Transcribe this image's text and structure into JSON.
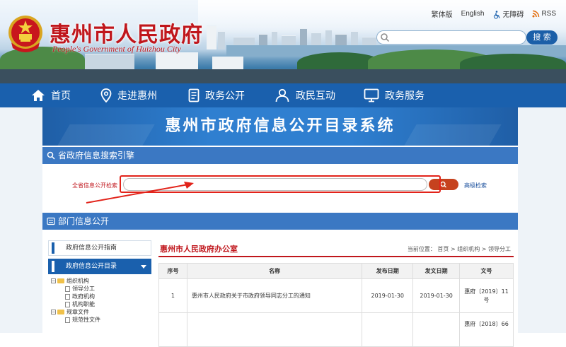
{
  "header": {
    "site_title": "惠州市人民政府",
    "site_subtitle": "People's Government of Huizhou City",
    "top_links": {
      "traditional": "繁体版",
      "english": "English",
      "accessible": "无障碍",
      "rss": "RSS"
    },
    "search": {
      "placeholder": "",
      "button_label": "搜 索"
    }
  },
  "nav": {
    "items": [
      {
        "label": "首页",
        "icon": "home-icon"
      },
      {
        "label": "走进惠州",
        "icon": "location-pin-icon"
      },
      {
        "label": "政务公开",
        "icon": "document-icon"
      },
      {
        "label": "政民互动",
        "icon": "people-icon"
      },
      {
        "label": "政务服务",
        "icon": "monitor-icon"
      }
    ]
  },
  "system_title": "惠州市政府信息公开目录系统",
  "province_search": {
    "section_title": "省政府信息搜索引擎",
    "label": "全省信息公开检索",
    "advanced_label": "高级检索"
  },
  "dept_section_title": "部门信息公开",
  "sidebar": {
    "items": [
      {
        "label": "政府信息公开指南"
      },
      {
        "label": "政府信息公开目录",
        "active": true
      }
    ],
    "tree": [
      {
        "label": "组织机构",
        "type": "folder",
        "expanded": true
      },
      {
        "label": "领导分工",
        "type": "doc"
      },
      {
        "label": "政府机构",
        "type": "doc"
      },
      {
        "label": "机构职能",
        "type": "doc"
      },
      {
        "label": "规章文件",
        "type": "folder",
        "expanded": true
      },
      {
        "label": "规范性文件",
        "type": "doc"
      }
    ]
  },
  "dept": {
    "name": "惠州市人民政府办公室",
    "location_label": "当前位置：",
    "breadcrumb": [
      "首页",
      "组织机构",
      "领导分工"
    ]
  },
  "table": {
    "headers": [
      "序号",
      "名称",
      "发布日期",
      "发文日期",
      "文号"
    ],
    "rows": [
      {
        "index": "1",
        "title": "惠州市人民政府关于市政府领导同志分工的通知",
        "publish_date": "2019-01-30",
        "issue_date": "2019-01-30",
        "doc_number": "惠府〔2019〕11号"
      },
      {
        "index": "",
        "title": "",
        "publish_date": "",
        "issue_date": "",
        "doc_number": "惠府〔2018〕66"
      }
    ]
  },
  "colors": {
    "nav_blue": "#1a60ad",
    "title_red": "#c0161c",
    "annotation_red": "#e2231a"
  }
}
